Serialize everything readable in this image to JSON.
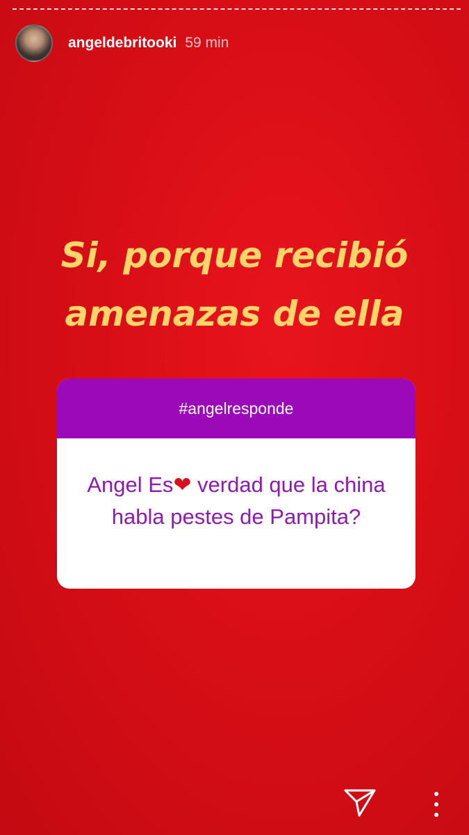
{
  "story": {
    "username": "angeldebritooki",
    "time": "59 min",
    "headline_line1": "Si, porque recibió",
    "headline_line2": "amenazas de ella"
  },
  "question_box": {
    "tag": "#angelresponde",
    "question_part1": "Angel Es",
    "heart": "❤",
    "question_part2": " verdad que la china habla pestes de Pampita?"
  },
  "controls": {
    "send_icon": "send-icon",
    "more_icon": "more-options-icon"
  },
  "colors": {
    "background": "#d80e16",
    "headline": "#ffd46a",
    "box_header": "#9b0ab8",
    "question_text": "#8e1ab0"
  }
}
